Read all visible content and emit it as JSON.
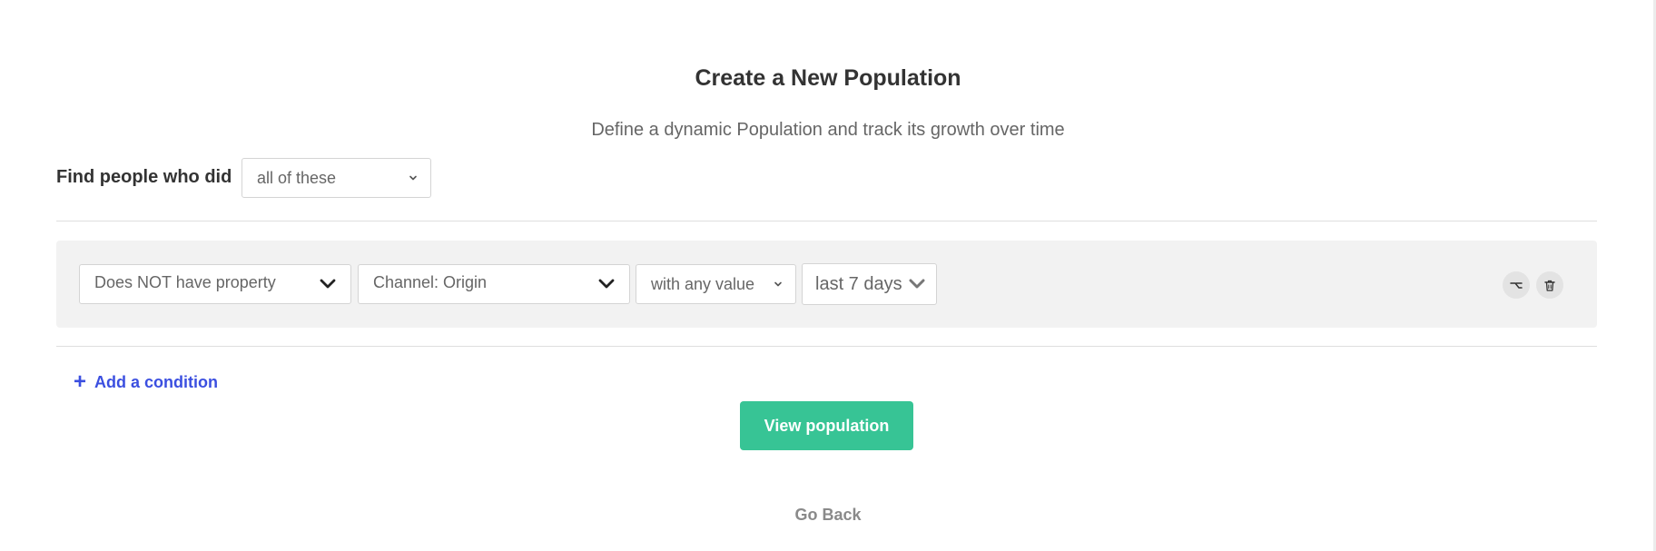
{
  "header": {
    "title": "Create a New Population",
    "subtitle": "Define a dynamic Population and track its growth over time"
  },
  "match": {
    "label": "Find people who did",
    "selected": "all of these"
  },
  "condition": {
    "property_filter": "Does NOT have property",
    "property_name": "Channel: Origin",
    "value_filter": "with any value",
    "time_range": "last 7 days",
    "actions": {
      "branch_icon": "branch-icon",
      "delete_icon": "trash-icon"
    }
  },
  "add_condition": {
    "label": "Add a condition"
  },
  "actions": {
    "view_label": "View population",
    "go_back_label": "Go Back"
  },
  "colors": {
    "primary_green": "#37c495",
    "link_blue": "#3b4fe0",
    "panel_gray": "#f2f2f2"
  }
}
